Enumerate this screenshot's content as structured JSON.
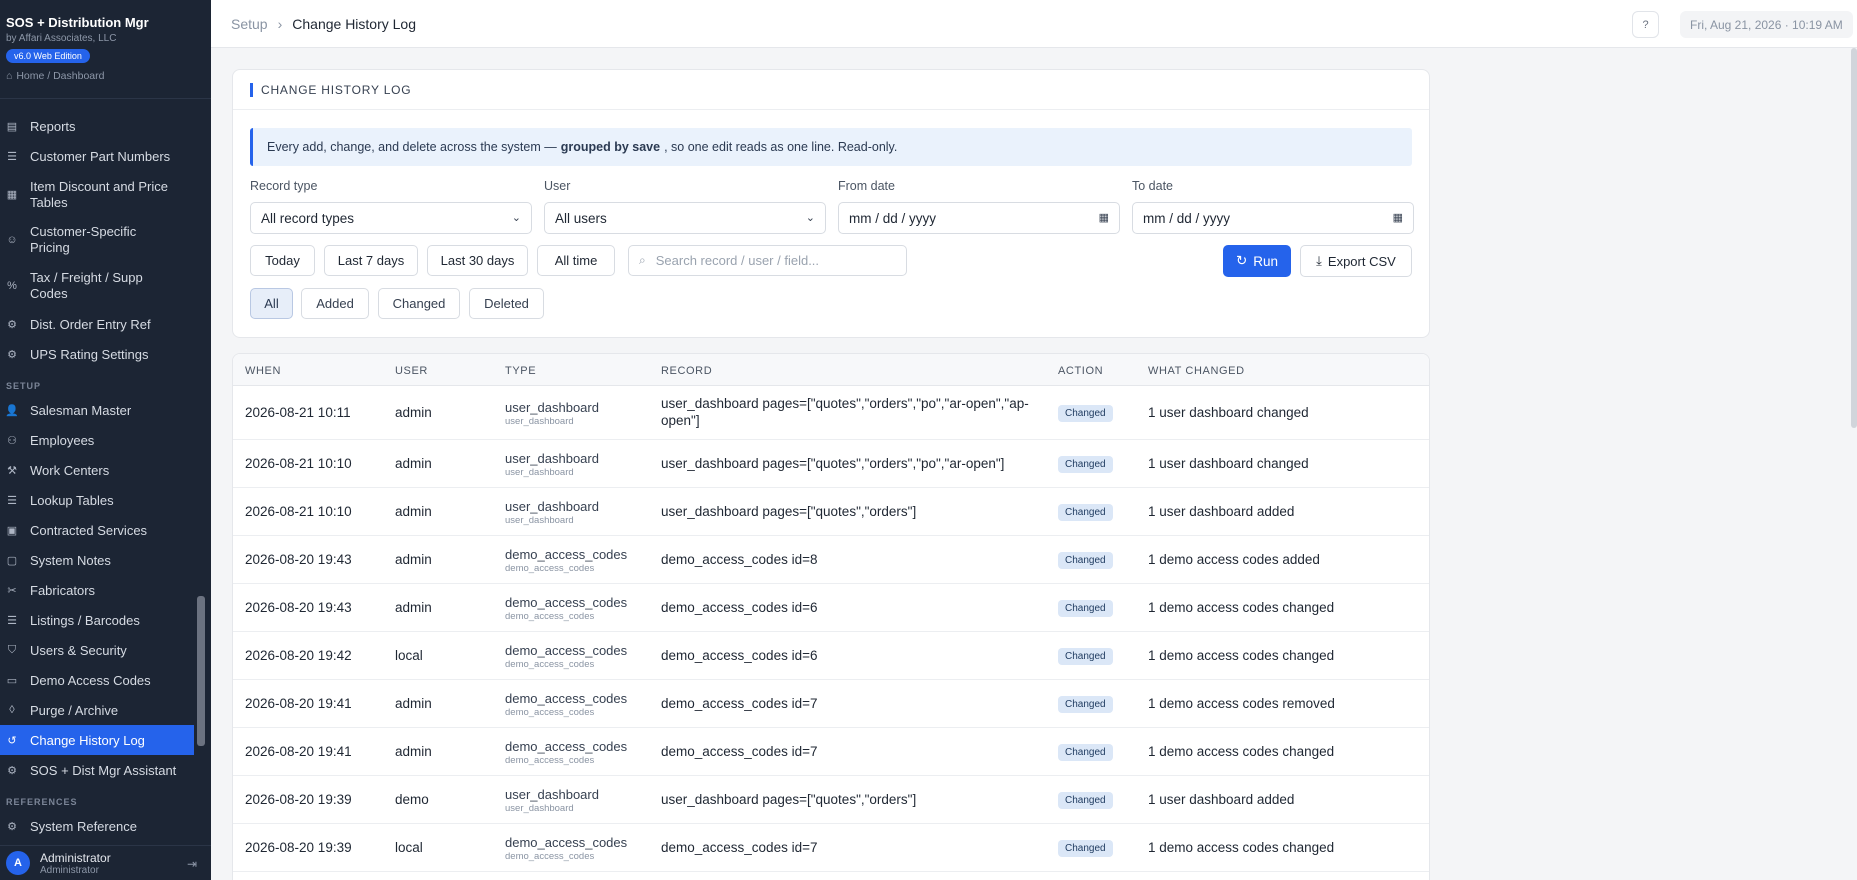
{
  "brand": {
    "title": "SOS + Distribution Mgr",
    "subtitle": "by Affari Associates, LLC",
    "badge": "v6.0 Web Edition",
    "crumb": "Home / Dashboard"
  },
  "sidebar": {
    "items": [
      {
        "label": "Reports",
        "icon": "chart-icon",
        "top": 0
      },
      {
        "label": "Customer Part Numbers",
        "icon": "list-icon"
      },
      {
        "label": "Item Discount and Price Tables",
        "icon": "table-icon"
      },
      {
        "label": "Customer-Specific Pricing",
        "icon": "user-tag-icon"
      },
      {
        "label": "Tax / Freight / Supp Codes",
        "icon": "percent-icon"
      },
      {
        "label": "Dist. Order Entry Ref",
        "icon": "gear-icon"
      },
      {
        "label": "UPS Rating Settings",
        "icon": "gear-icon"
      }
    ],
    "setup_section": "SETUP",
    "setup_items": [
      {
        "label": "Salesman Master",
        "icon": "person-icon"
      },
      {
        "label": "Employees",
        "icon": "people-icon"
      },
      {
        "label": "Work Centers",
        "icon": "wrench-icon"
      },
      {
        "label": "Lookup Tables",
        "icon": "list-icon"
      },
      {
        "label": "Contracted Services",
        "icon": "briefcase-icon"
      },
      {
        "label": "System Notes",
        "icon": "note-icon"
      },
      {
        "label": "Fabricators",
        "icon": "scissors-icon"
      },
      {
        "label": "Listings / Barcodes",
        "icon": "barcode-icon"
      },
      {
        "label": "Users & Security",
        "icon": "shield-icon"
      },
      {
        "label": "Demo Access Codes",
        "icon": "key-icon"
      },
      {
        "label": "Purge / Archive",
        "icon": "trash-icon"
      },
      {
        "label": "Change History Log",
        "icon": "history-icon"
      },
      {
        "label": "SOS + Dist Mgr Assistant",
        "icon": "robot-icon"
      }
    ],
    "references_section": "REFERENCES",
    "reference_items": [
      {
        "label": "System Reference",
        "icon": "gear-icon"
      }
    ]
  },
  "user": {
    "initial": "A",
    "name": "Administrator",
    "role": "Administrator"
  },
  "topbar": {
    "crumb_root": "Setup",
    "crumb_current": "Change History Log",
    "datetime": "Fri, Aug 21, 2026 · 10:19 AM"
  },
  "panel": {
    "title": "CHANGE HISTORY LOG",
    "info_pre": "Every add, change, and delete across the system —",
    "info_bold": "grouped by save",
    "info_post": ", so one edit reads as one line. Read-only.",
    "record_type_label": "Record type",
    "record_type_value": "All record types",
    "user_label": "User",
    "user_value": "All users",
    "from_label": "From date",
    "from_placeholder": "mm / dd / yyyy",
    "to_label": "To date",
    "to_placeholder": "mm / dd / yyyy",
    "quick": [
      "Today",
      "Last 7 days",
      "Last 30 days",
      "All time"
    ],
    "search_placeholder": "Search record / user / field...",
    "run_label": "Run",
    "export_label": "Export CSV",
    "segments": [
      "All",
      "Added",
      "Changed",
      "Deleted"
    ]
  },
  "table": {
    "headers": [
      "WHEN",
      "USER",
      "TYPE",
      "RECORD",
      "ACTION",
      "WHAT CHANGED"
    ],
    "rows": [
      {
        "when": "2026-08-21 10:11",
        "user": "admin",
        "type": "user_dashboard",
        "type_sub": "user_dashboard",
        "record": "user_dashboard pages=[\"quotes\",\"orders\",\"po\",\"ar-open\",\"ap-",
        "record2": "open\"]",
        "action": "Changed",
        "what": "1 user dashboard changed"
      },
      {
        "when": "2026-08-21 10:10",
        "user": "admin",
        "type": "user_dashboard",
        "type_sub": "user_dashboard",
        "record": "user_dashboard pages=[\"quotes\",\"orders\",\"po\",\"ar-open\"]",
        "record2": "",
        "action": "Changed",
        "what": "1 user dashboard changed"
      },
      {
        "when": "2026-08-21 10:10",
        "user": "admin",
        "type": "user_dashboard",
        "type_sub": "user_dashboard",
        "record": "user_dashboard pages=[\"quotes\",\"orders\"]",
        "record2": "",
        "action": "Changed",
        "what": "1 user dashboard added"
      },
      {
        "when": "2026-08-20 19:43",
        "user": "admin",
        "type": "demo_access_codes",
        "type_sub": "demo_access_codes",
        "record": "demo_access_codes id=8",
        "record2": "",
        "action": "Changed",
        "what": "1 demo access codes added"
      },
      {
        "when": "2026-08-20 19:43",
        "user": "admin",
        "type": "demo_access_codes",
        "type_sub": "demo_access_codes",
        "record": "demo_access_codes id=6",
        "record2": "",
        "action": "Changed",
        "what": "1 demo access codes changed"
      },
      {
        "when": "2026-08-20 19:42",
        "user": "local",
        "type": "demo_access_codes",
        "type_sub": "demo_access_codes",
        "record": "demo_access_codes id=6",
        "record2": "",
        "action": "Changed",
        "what": "1 demo access codes changed"
      },
      {
        "when": "2026-08-20 19:41",
        "user": "admin",
        "type": "demo_access_codes",
        "type_sub": "demo_access_codes",
        "record": "demo_access_codes id=7",
        "record2": "",
        "action": "Changed",
        "what": "1 demo access codes removed"
      },
      {
        "when": "2026-08-20 19:41",
        "user": "admin",
        "type": "demo_access_codes",
        "type_sub": "demo_access_codes",
        "record": "demo_access_codes id=7",
        "record2": "",
        "action": "Changed",
        "what": "1 demo access codes changed"
      },
      {
        "when": "2026-08-20 19:39",
        "user": "demo",
        "type": "user_dashboard",
        "type_sub": "user_dashboard",
        "record": "user_dashboard pages=[\"quotes\",\"orders\"]",
        "record2": "",
        "action": "Changed",
        "what": "1 user dashboard added"
      },
      {
        "when": "2026-08-20 19:39",
        "user": "local",
        "type": "demo_access_codes",
        "type_sub": "demo_access_codes",
        "record": "demo_access_codes id=7",
        "record2": "",
        "action": "Changed",
        "what": "1 demo access codes changed"
      }
    ]
  }
}
